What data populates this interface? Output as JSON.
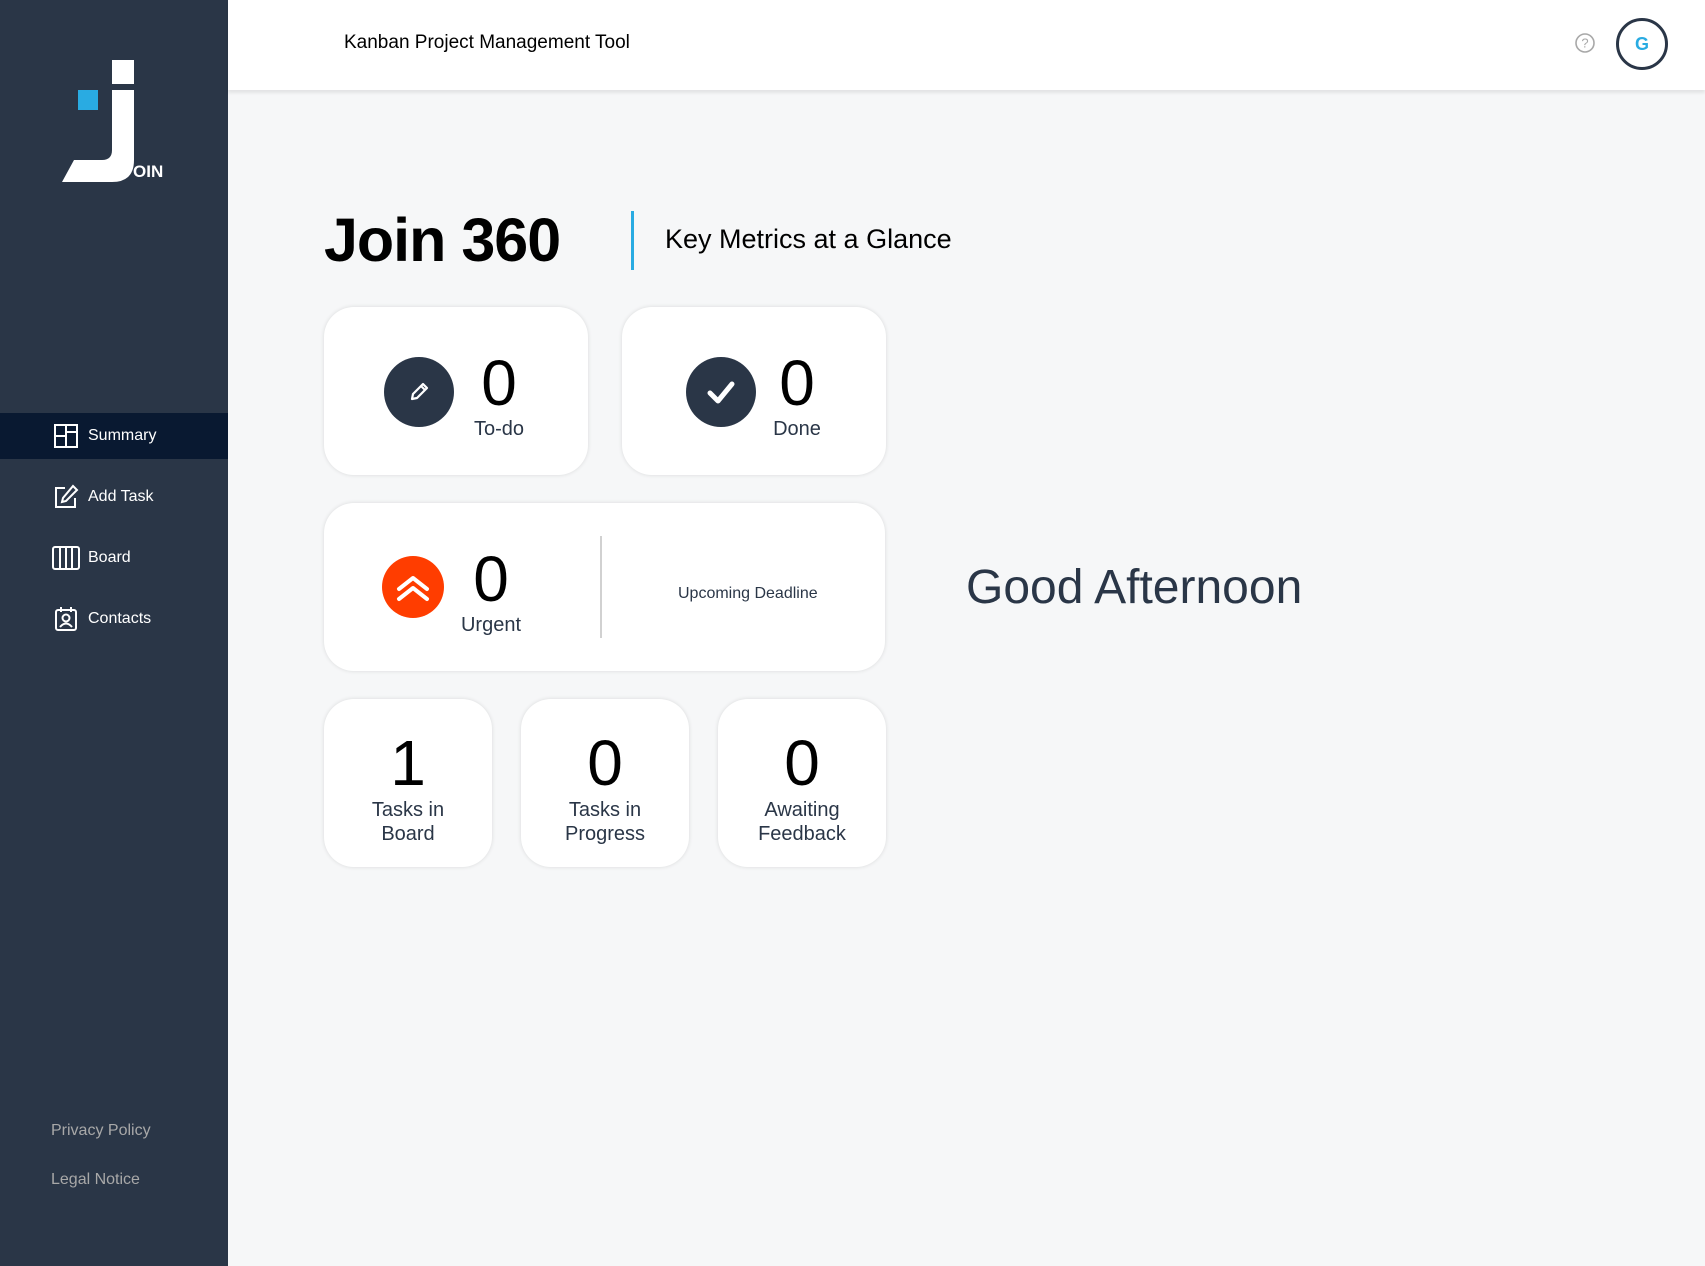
{
  "app": {
    "logo_text": "OIN",
    "header_title": "Kanban Project Management Tool",
    "user_initial": "G",
    "accent_color": "#29abe2",
    "sidebar_color": "#2a3647",
    "urgent_color": "#ff3d00"
  },
  "sidebar": {
    "items": [
      {
        "label": "Summary",
        "icon": "summary-icon",
        "active": true
      },
      {
        "label": "Add Task",
        "icon": "add-task-icon",
        "active": false
      },
      {
        "label": "Board",
        "icon": "board-icon",
        "active": false
      },
      {
        "label": "Contacts",
        "icon": "contacts-icon",
        "active": false
      }
    ],
    "footer": [
      "Privacy Policy",
      "Legal Notice"
    ]
  },
  "main": {
    "title": "Join 360",
    "subtitle": "Key Metrics at a Glance",
    "greeting": "Good Afternoon",
    "metrics": {
      "todo": {
        "count": "0",
        "label": "To-do",
        "icon": "pencil-icon"
      },
      "done": {
        "count": "0",
        "label": "Done",
        "icon": "check-icon"
      },
      "urgent": {
        "count": "0",
        "label": "Urgent",
        "icon": "double-chevron-up-icon"
      },
      "upcoming_deadline": {
        "label": "Upcoming Deadline"
      },
      "tasks_in_board": {
        "count": "1",
        "label_line1": "Tasks in",
        "label_line2": "Board"
      },
      "tasks_in_progress": {
        "count": "0",
        "label_line1": "Tasks in",
        "label_line2": "Progress"
      },
      "awaiting_feedback": {
        "count": "0",
        "label_line1": "Awaiting",
        "label_line2": "Feedback"
      }
    }
  }
}
